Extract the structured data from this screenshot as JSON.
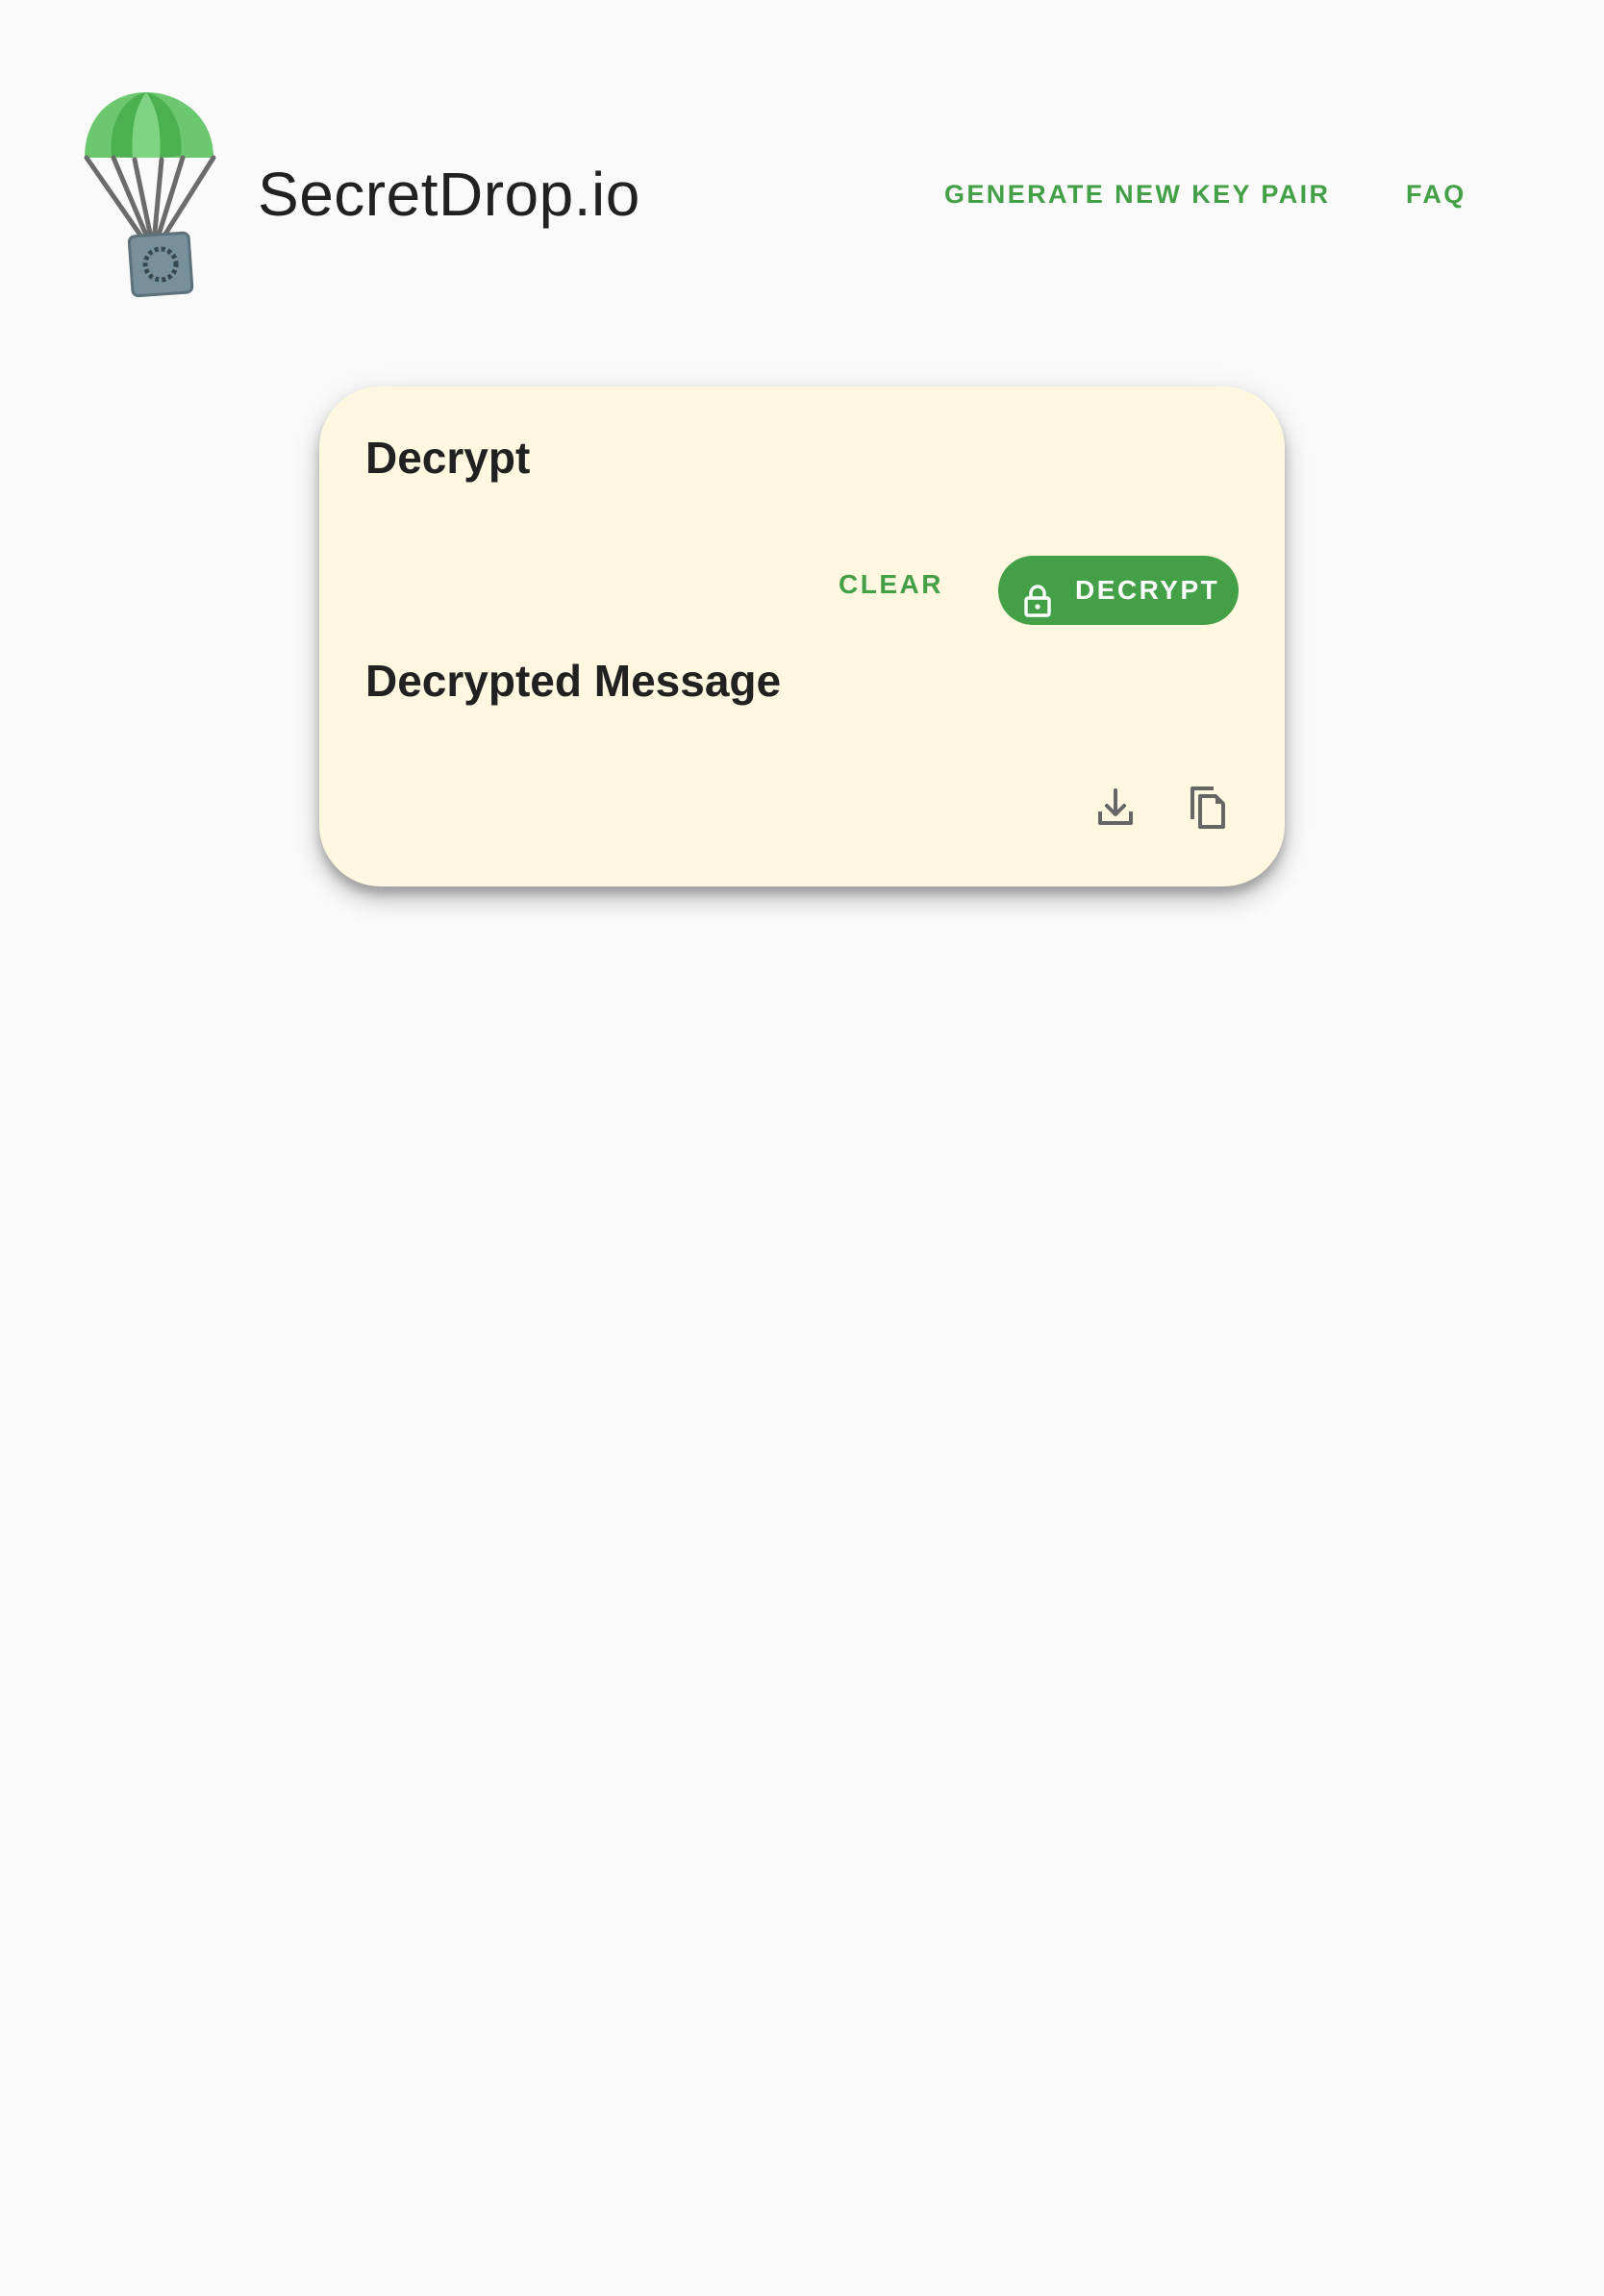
{
  "header": {
    "brand": "SecretDrop.io",
    "nav": {
      "generate_label": "GENERATE NEW KEY PAIR",
      "faq_label": "FAQ"
    }
  },
  "card": {
    "title": "Decrypt",
    "clear_label": "CLEAR",
    "decrypt_label": "DECRYPT",
    "output_title": "Decrypted Message",
    "icons": [
      "download-icon",
      "copy-icon",
      "lock-icon"
    ]
  },
  "colors": {
    "accent": "#43a047",
    "card_background": "#fff7e0",
    "page_background": "#fafafa",
    "text": "#212121"
  }
}
